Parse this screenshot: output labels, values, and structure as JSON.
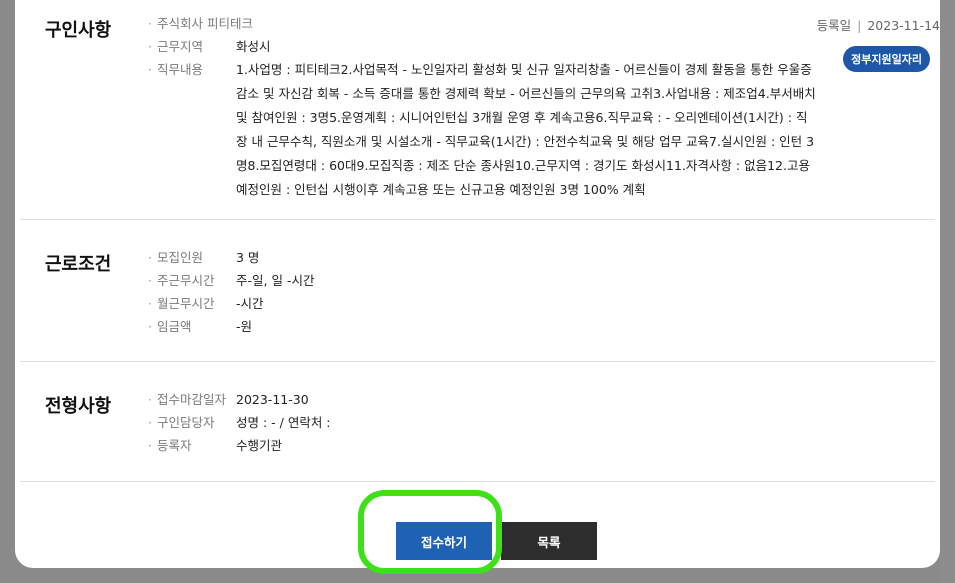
{
  "registration": {
    "label": "등록일",
    "date": "2023-11-14",
    "separator": "|"
  },
  "badge": "정부지원일자리",
  "recruit": {
    "title": "구인사항",
    "company": "주식회사 피티테크",
    "region_label": "근무지역",
    "region_value": "화성시",
    "duty_label": "직무내용",
    "duty_value": "1.사업명 : 피티테크2.사업목적 - 노인일자리 활성화 및 신규 일자리창출 - 어르신들이 경제 활동을 통한 우울증 감소 및 자신감 회복 - 소득 증대를 통한 경제력 확보 - 어르신들의 근무의욕 고취3.사업내용 : 제조업4.부서배치 및 참여인원 : 3명5.운영계획 : 시니어인턴십 3개월 운영 후 계속고용6.직무교육 : - 오리엔테이션(1시간) : 직장 내 근무수칙, 직원소개 및 시설소개 - 직무교육(1시간) : 안전수칙교육 및 해당 업무 교육7.실시인원 : 인턴 3명8.모집연령대 : 60대9.모집직종 : 제조 단순 종사원10.근무지역 : 경기도 화성시11.자격사항 : 없음12.고용예정인원 : 인턴십 시행이후 계속고용 또는 신규고용 예정인원 3명 100% 계획"
  },
  "conditions": {
    "title": "근로조건",
    "rows": [
      {
        "label": "모집인원",
        "value": "3 명"
      },
      {
        "label": "주근무시간",
        "value": "주-일, 일 -시간"
      },
      {
        "label": "월근무시간",
        "value": "-시간"
      },
      {
        "label": "임금액",
        "value": "-원"
      }
    ]
  },
  "screening": {
    "title": "전형사항",
    "rows": [
      {
        "label": "접수마감일자",
        "value": "2023-11-30"
      },
      {
        "label": "구인담당자",
        "value": "성명 : - / 연락처 :"
      },
      {
        "label": "등록자",
        "value": "수행기관"
      }
    ]
  },
  "buttons": {
    "apply": "접수하기",
    "list": "목록"
  },
  "colors": {
    "apply_button": "#1f62b4",
    "list_button": "#2d2d2d",
    "badge": "#1f57a8",
    "highlight": "#3ee01a"
  }
}
